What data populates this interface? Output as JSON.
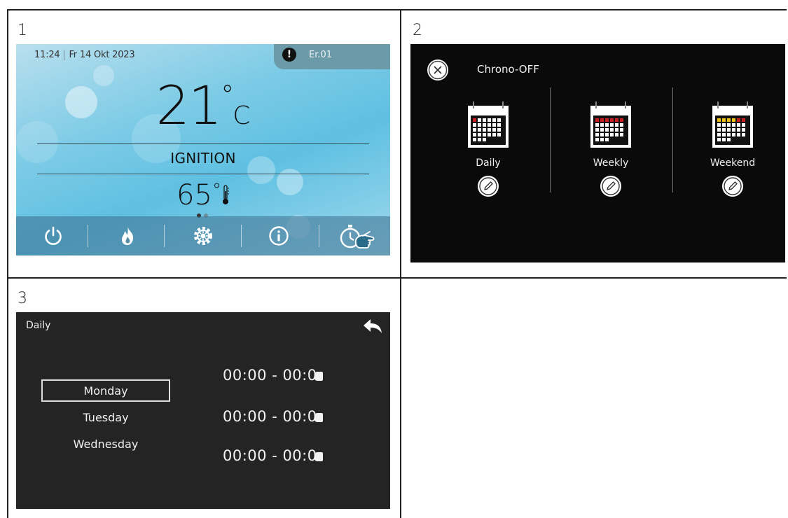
{
  "cells": [
    "1",
    "2",
    "3"
  ],
  "panel1": {
    "time": "11:24",
    "date": "Fr 14 Okt 2023",
    "error_code": "Er.01",
    "room_temp": "21",
    "room_unit": "C",
    "state": "IGNITION",
    "water_temp": "65",
    "page_indicator": {
      "pages": 2,
      "current": 1
    },
    "bottom_icons": [
      "power-icon",
      "flame-icon",
      "gear-icon",
      "info-icon",
      "chrono-timer-icon"
    ],
    "touch_indicator": "pointing-hand-icon",
    "colors": {
      "screen": "#5fc0e2",
      "bar": "#3c6e8c",
      "error_tab": "#6b9aa8"
    }
  },
  "panel2": {
    "title": "Chrono-OFF",
    "close_icon": "close-icon",
    "modes": [
      {
        "label": "Daily",
        "icon": "calendar-daily-icon",
        "edit_icon": "pencil-icon"
      },
      {
        "label": "Weekly",
        "icon": "calendar-weekly-icon",
        "edit_icon": "pencil-icon"
      },
      {
        "label": "Weekend",
        "icon": "calendar-weekend-icon",
        "edit_icon": "pencil-icon"
      }
    ],
    "colors": {
      "background": "#0a0a0a",
      "marker_red": "#cc1f1f",
      "marker_yellow": "#f2c21b"
    }
  },
  "panel3": {
    "title": "Daily",
    "back_icon": "back-arrow-icon",
    "days": [
      {
        "label": "Monday",
        "selected": true
      },
      {
        "label": "Tuesday",
        "selected": false
      },
      {
        "label": "Wednesday",
        "selected": false
      }
    ],
    "slots": [
      "00:00 - 00:0",
      "00:00 - 00:0",
      "00:00 - 00:0"
    ],
    "colors": {
      "background": "#242424"
    }
  }
}
